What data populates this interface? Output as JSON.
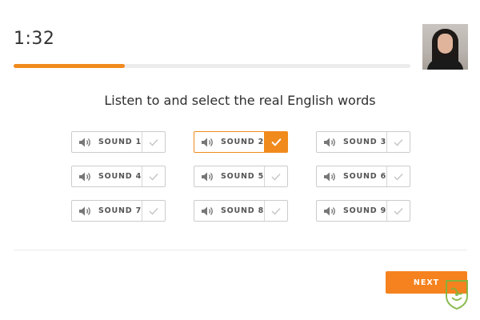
{
  "header": {
    "timer": "1:32"
  },
  "progress": {
    "fraction": 0.28
  },
  "instruction": "Listen to and select the real English words",
  "sounds": [
    {
      "label": "SOUND 1",
      "selected": false
    },
    {
      "label": "SOUND 2",
      "selected": true
    },
    {
      "label": "SOUND 3",
      "selected": false
    },
    {
      "label": "SOUND 4",
      "selected": false
    },
    {
      "label": "SOUND 5",
      "selected": false
    },
    {
      "label": "SOUND 6",
      "selected": false
    },
    {
      "label": "SOUND 7",
      "selected": false
    },
    {
      "label": "SOUND 8",
      "selected": false
    },
    {
      "label": "SOUND 9",
      "selected": false
    }
  ],
  "footer": {
    "next_label": "NEXT"
  },
  "icons": {
    "sound": "speaker-icon",
    "check": "checkmark-icon"
  },
  "colors": {
    "accent": "#f08a1c",
    "track": "#ececec",
    "border": "#cccccc",
    "check_idle": "#c8c8c8",
    "text": "#2e2e2e",
    "watermark": "#7db53c"
  }
}
